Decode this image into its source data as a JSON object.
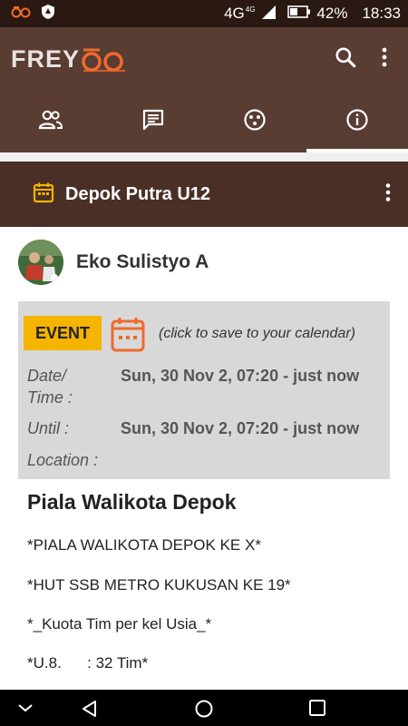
{
  "status_bar": {
    "network": "4G",
    "network_sup": "4G",
    "battery": "42%",
    "time": "18:33",
    "left_icons": [
      "freyoo-notification-icon",
      "shield-notification-icon"
    ]
  },
  "app": {
    "logo_text": "FREY",
    "actions": [
      "search-icon",
      "more-vert-icon"
    ]
  },
  "tabs": [
    {
      "icon": "people-icon",
      "active": false
    },
    {
      "icon": "chat-icon",
      "active": false
    },
    {
      "icon": "dots-circle-icon",
      "active": false
    },
    {
      "icon": "info-icon",
      "active": true
    }
  ],
  "group": {
    "title": "Depok Putra U12"
  },
  "post": {
    "author": "Eko Sulistyo A",
    "event": {
      "badge": "EVENT",
      "hint": "(click to save to your calendar)",
      "date_label_1": "Date/",
      "date_label_2": "Time :",
      "date_value": "Sun, 30 Nov 2, 07:20 - just now",
      "until_label": "Until :",
      "until_value": "Sun, 30 Nov 2, 07:20 - just now",
      "location_label": "Location :"
    },
    "title": "Piala Walikota Depok",
    "lines": [
      "*PIALA WALIKOTA DEPOK KE X*",
      "*HUT SSB METRO KUKUSAN KE 19*",
      "*_Kuota Tim per kel Usia_*",
      "*U.8.      : 32 Tim*"
    ]
  },
  "colors": {
    "app_bar": "#593c32",
    "group_header": "#4a2f26",
    "event_badge": "#f5b400",
    "calendar_accent": "#f06a2c"
  }
}
